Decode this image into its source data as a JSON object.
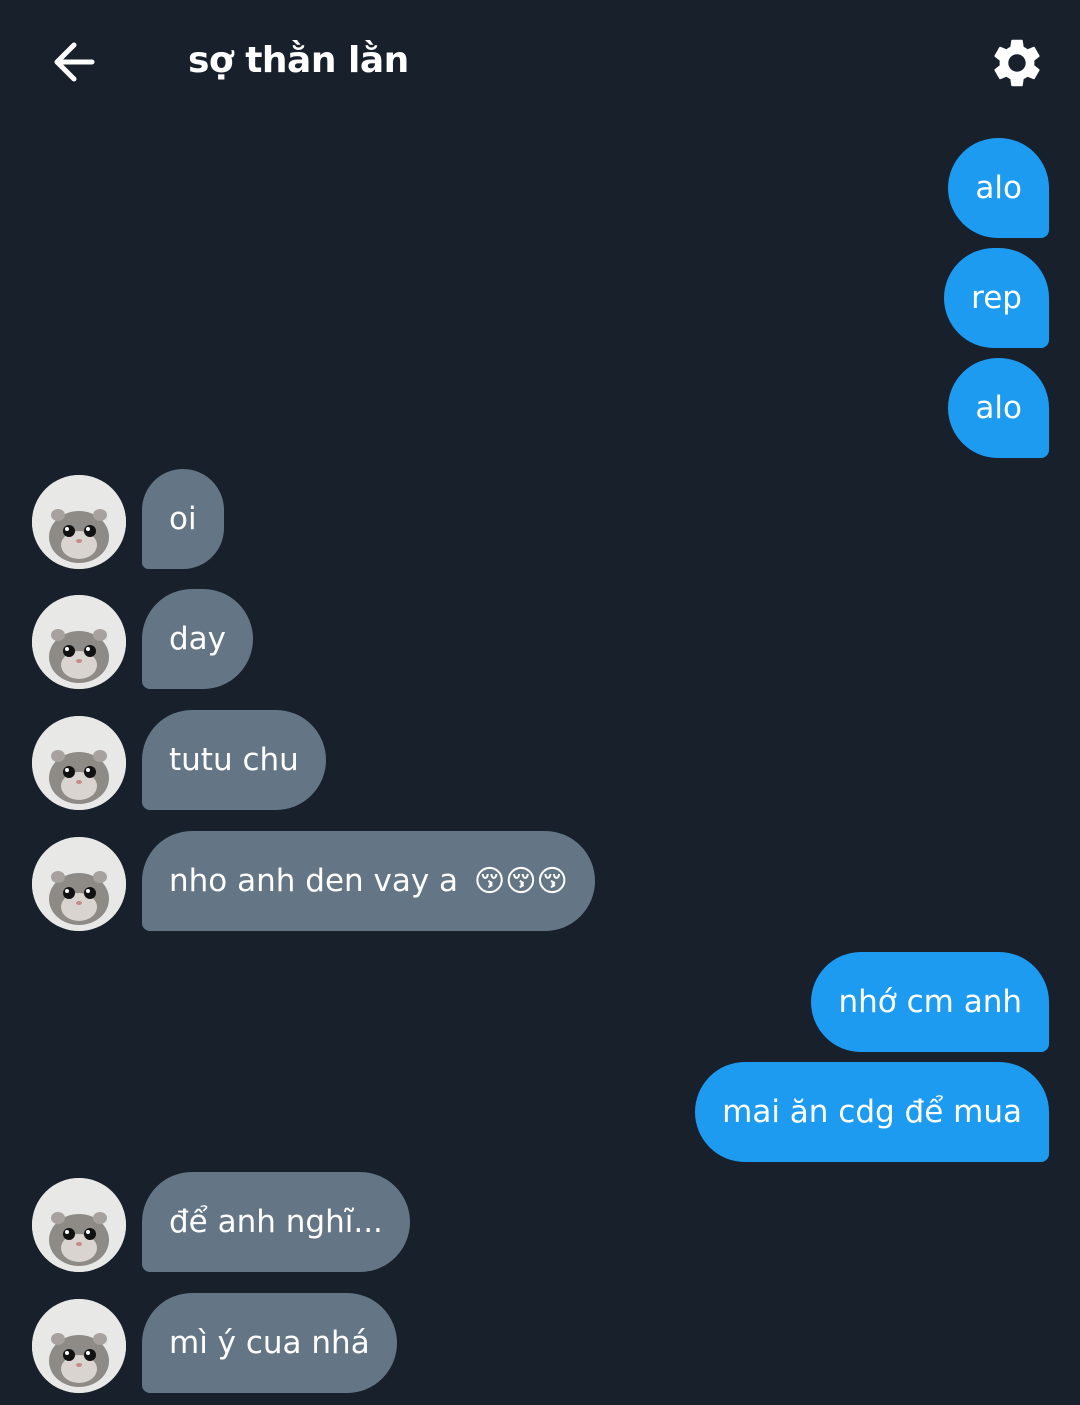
{
  "header": {
    "title": "sợ thằn lằn",
    "back_icon": "arrow-left-icon",
    "settings_icon": "gear-icon"
  },
  "colors": {
    "background": "#17202b",
    "outgoing_bubble": "#1d9bf0",
    "incoming_bubble": "#647686"
  },
  "messages": [
    {
      "side": "out",
      "text": "alo"
    },
    {
      "side": "out",
      "text": "rep"
    },
    {
      "side": "out",
      "text": "alo"
    },
    {
      "side": "in",
      "text": "oi"
    },
    {
      "side": "in",
      "text": "day"
    },
    {
      "side": "in",
      "text": "tutu chu"
    },
    {
      "side": "in",
      "text": "nho anh den vay a",
      "emoji": "😚😚😚"
    },
    {
      "side": "out",
      "text": "nhớ cm anh"
    },
    {
      "side": "out",
      "text": "mai ăn cdg để mua"
    },
    {
      "side": "in",
      "text": "để anh nghĩ..."
    },
    {
      "side": "in",
      "text": "mì ý cua nhá"
    }
  ]
}
